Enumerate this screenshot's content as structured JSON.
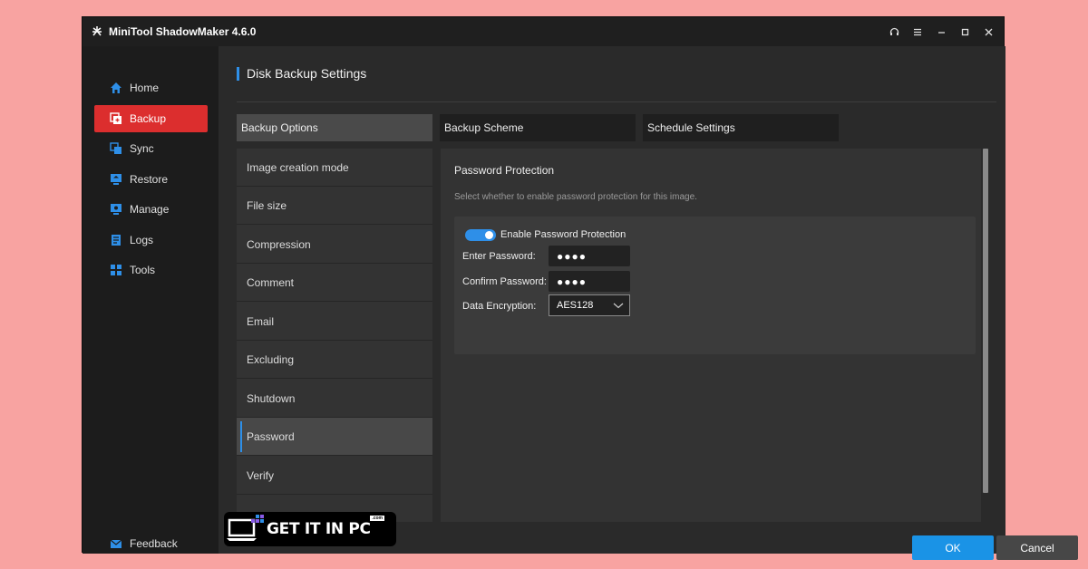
{
  "window": {
    "title": "MiniTool ShadowMaker 4.6.0",
    "controls": [
      "headset-icon",
      "menu-icon",
      "minimize-icon",
      "maximize-icon",
      "close-icon"
    ]
  },
  "sidebar": {
    "items": [
      {
        "label": "Home",
        "icon": "home-icon",
        "active": false
      },
      {
        "label": "Backup",
        "icon": "backup-icon",
        "active": true
      },
      {
        "label": "Sync",
        "icon": "sync-icon",
        "active": false
      },
      {
        "label": "Restore",
        "icon": "restore-icon",
        "active": false
      },
      {
        "label": "Manage",
        "icon": "manage-icon",
        "active": false
      },
      {
        "label": "Logs",
        "icon": "logs-icon",
        "active": false
      },
      {
        "label": "Tools",
        "icon": "tools-icon",
        "active": false
      }
    ],
    "feedback": {
      "label": "Feedback",
      "icon": "mail-icon"
    }
  },
  "main": {
    "title": "Disk Backup Settings",
    "tabs": [
      {
        "label": "Backup Options",
        "active": true
      },
      {
        "label": "Backup Scheme",
        "active": false
      },
      {
        "label": "Schedule Settings",
        "active": false
      }
    ],
    "options": [
      {
        "label": "Image creation mode",
        "active": false
      },
      {
        "label": "File size",
        "active": false
      },
      {
        "label": "Compression",
        "active": false
      },
      {
        "label": "Comment",
        "active": false
      },
      {
        "label": "Email",
        "active": false
      },
      {
        "label": "Excluding",
        "active": false
      },
      {
        "label": "Shutdown",
        "active": false
      },
      {
        "label": "Password",
        "active": true
      },
      {
        "label": "Verify",
        "active": false
      }
    ],
    "panel": {
      "title": "Password Protection",
      "description": "Select whether to enable password protection for this image.",
      "toggle_label": "Enable Password Protection",
      "toggle_on": true,
      "enter_password_label": "Enter Password:",
      "enter_password_value": "●●●●",
      "confirm_password_label": "Confirm Password:",
      "confirm_password_value": "●●●●",
      "encryption_label": "Data Encryption:",
      "encryption_value": "AES128"
    },
    "ok_label": "OK",
    "cancel_label": "Cancel"
  },
  "watermark": {
    "text": "GET IT IN PC",
    "suffix": ".com"
  },
  "colors": {
    "accent": "#2e8fe8",
    "active_nav": "#dc2e2e",
    "ok_button": "#1a93e6",
    "page_background": "#f8a3a1"
  }
}
